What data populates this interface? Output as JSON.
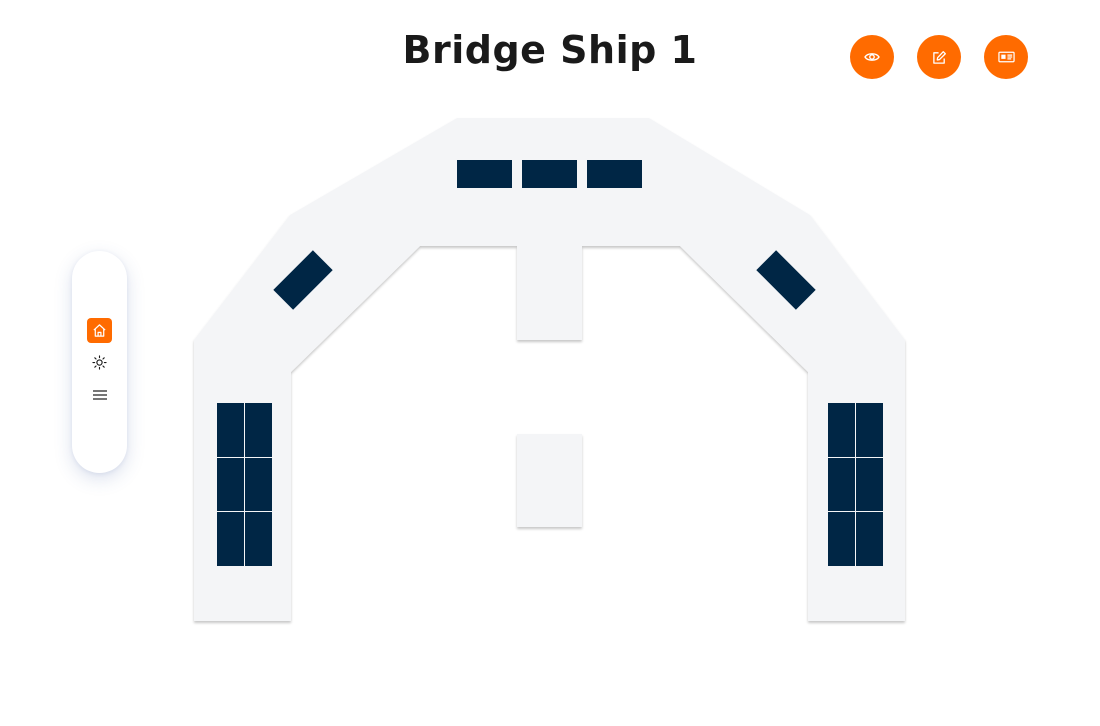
{
  "header": {
    "title": "Bridge Ship 1"
  },
  "actions": [
    {
      "name": "view-button",
      "icon": "eye-icon"
    },
    {
      "name": "edit-button",
      "icon": "edit-icon"
    },
    {
      "name": "details-button",
      "icon": "id-card-icon"
    }
  ],
  "sidebar": {
    "tools": [
      {
        "name": "home-tool",
        "icon": "home-icon",
        "active": true
      },
      {
        "name": "brightness-tool",
        "icon": "sun-icon",
        "active": false
      },
      {
        "name": "menu-tool",
        "icon": "menu-icon",
        "active": false
      }
    ]
  },
  "colors": {
    "accent": "#ff6b00",
    "floor": "#f4f5f7",
    "desk": "#002645",
    "icon_dark": "#1a1a1a",
    "title": "#1a1a1a"
  }
}
